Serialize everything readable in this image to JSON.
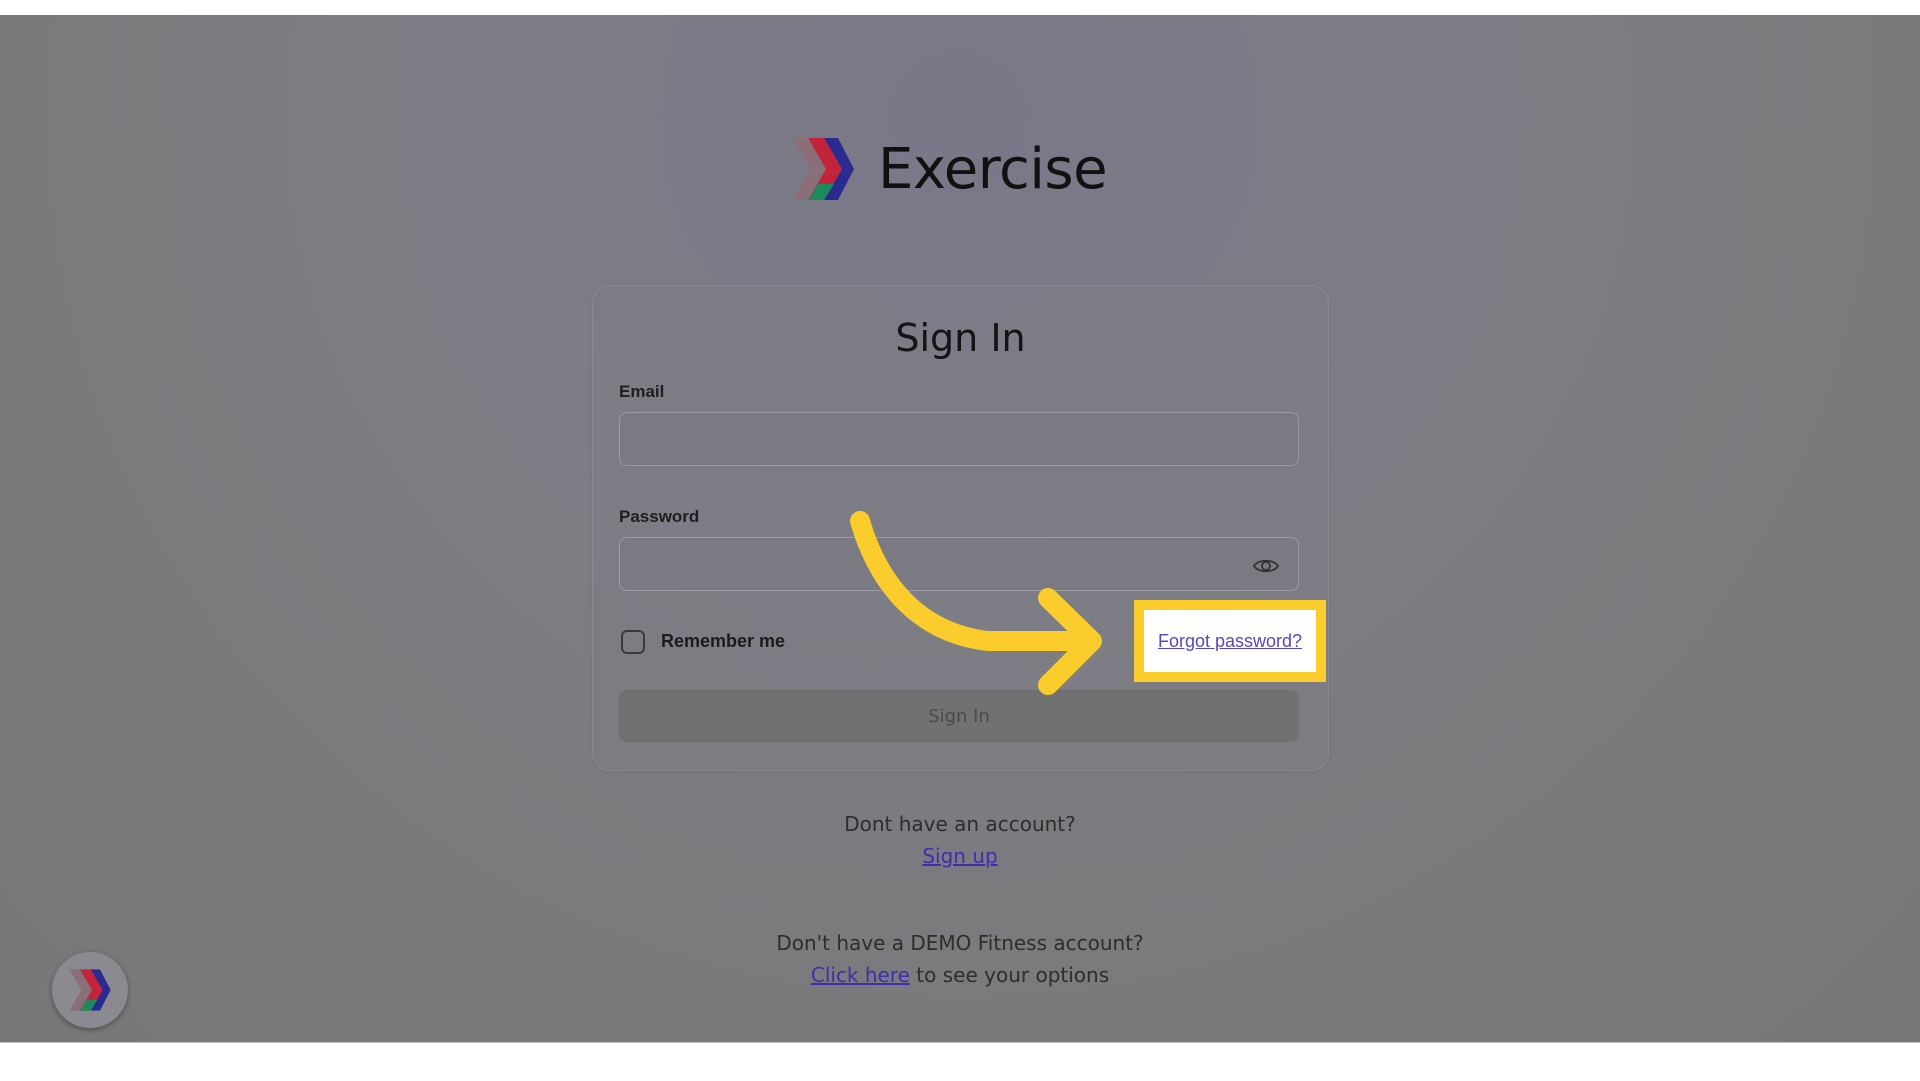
{
  "app": {
    "name": "Exercise"
  },
  "form": {
    "title": "Sign In",
    "email_label": "Email",
    "email_value": "",
    "password_label": "Password",
    "password_value": "",
    "remember_label": "Remember me",
    "remember_checked": false,
    "forgot_label": "Forgot password?",
    "submit_label": "Sign In"
  },
  "signup": {
    "prompt": "Dont have an account?",
    "link": "Sign up"
  },
  "demo": {
    "prompt": "Don't have a DEMO Fitness account?",
    "link": "Click here",
    "suffix": " to see your options"
  },
  "icons": {
    "logo": "exercise-logo-icon",
    "eye": "eye-icon",
    "widget": "chat-widget-icon",
    "annotation_arrow": "annotation-arrow-icon"
  },
  "colors": {
    "highlight": "#fbcd2c",
    "link": "#5b48b4"
  }
}
